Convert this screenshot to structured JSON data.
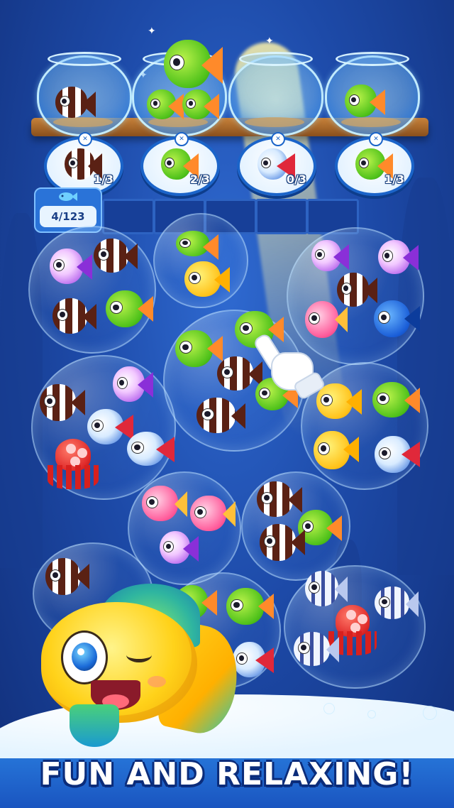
{
  "targets": [
    {
      "fish": "striped-fish",
      "count": "1/3"
    },
    {
      "fish": "green-fish",
      "count": "2/3"
    },
    {
      "fish": "betta-fish",
      "count": "0/3"
    },
    {
      "fish": "green-fish",
      "count": "1/3"
    }
  ],
  "progress": {
    "icon": "fish-icon",
    "value": "4/123"
  },
  "slots": 5,
  "banner": {
    "text": "FUN AND RELAXING!"
  },
  "colors": {
    "background": "#1d4aa8",
    "accent": "#1b64c9",
    "banner_text": "#ffffff",
    "banner_outline": "#0b2c7a"
  }
}
